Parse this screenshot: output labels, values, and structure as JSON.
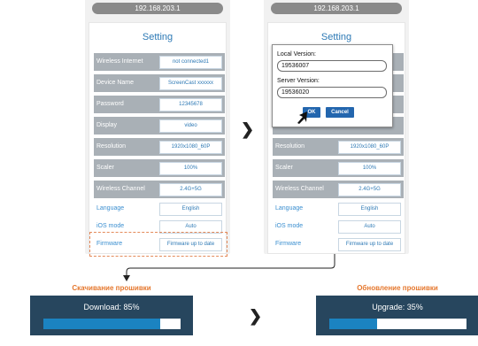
{
  "left_phone": {
    "url": "192.168.203.1",
    "title": "Setting",
    "rows": [
      {
        "label": "Wireless Internet",
        "value": "not connected1"
      },
      {
        "label": "Device Name",
        "value": "ScreenCast xxxxxx"
      },
      {
        "label": "Password",
        "value": "12345678"
      },
      {
        "label": "Display",
        "value": "video"
      },
      {
        "label": "Resolution",
        "value": "1920x1080_60P"
      },
      {
        "label": "Scaler",
        "value": "100%"
      },
      {
        "label": "Wireless Channel",
        "value": "2.4G+5G"
      },
      {
        "label": "Language",
        "value": "English"
      },
      {
        "label": "iOS mode",
        "value": "Auto"
      },
      {
        "label": "Firmware",
        "value": "Firmware up to date"
      }
    ]
  },
  "right_phone": {
    "url": "192.168.203.1",
    "title": "Setting",
    "rows": [
      {
        "label": "Resolution",
        "value": "1920x1080_60P"
      },
      {
        "label": "Scaler",
        "value": "100%"
      },
      {
        "label": "Wireless Channel",
        "value": "2.4G+5G"
      },
      {
        "label": "Language",
        "value": "English"
      },
      {
        "label": "iOS mode",
        "value": "Auto"
      },
      {
        "label": "Firmware",
        "value": "Firmware up to date"
      }
    ]
  },
  "dialog": {
    "local_label": "Local Version:",
    "local_value": "19536007",
    "server_label": "Server Version:",
    "server_value": "19536020",
    "ok_label": "OK",
    "cancel_label": "Cancel"
  },
  "download": {
    "caption": "Скачивание прошивки",
    "text": "Download: 85%",
    "progress": 0.85
  },
  "upgrade": {
    "caption": "Обновление прошивки",
    "text": "Upgrade: 35%",
    "progress": 0.35
  },
  "colors": {
    "accent": "#2d79b5",
    "caption": "#e5772d",
    "panel": "#27465e",
    "progress": "#1b83c1"
  }
}
